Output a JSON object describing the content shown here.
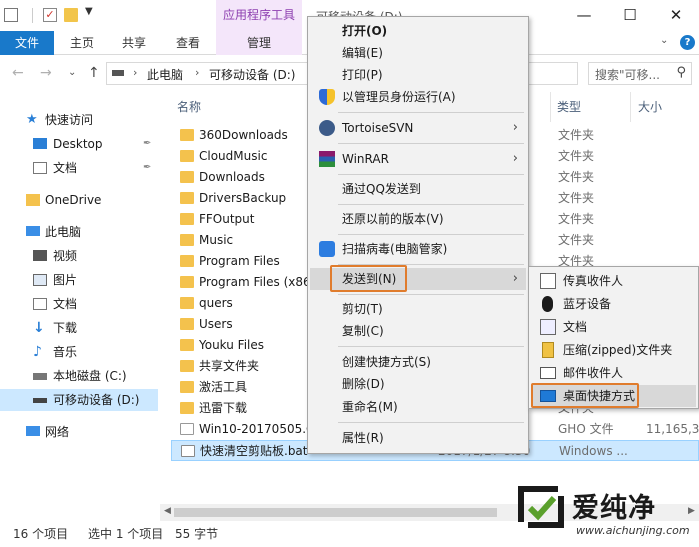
{
  "titlebar": {
    "context_tab": "应用程序工具",
    "window_title": "可移动设备 (D:)",
    "minimize": "—",
    "maximize": "☐",
    "close": "✕"
  },
  "ribbon": {
    "tabs": [
      "文件",
      "主页",
      "共享",
      "查看",
      "管理"
    ],
    "chevron": "⌄",
    "help": "?"
  },
  "address": {
    "back": "←",
    "forward": "→",
    "history": "⌄",
    "up": "↑",
    "crumbs": [
      "此电脑",
      "可移动设备 (D:)"
    ],
    "separator": "›",
    "dropdown": "⌄",
    "refresh": "↻",
    "search_placeholder": "搜索\"可移...",
    "search_icon": "⚲"
  },
  "nav": {
    "items": [
      {
        "label": "快速访问",
        "icon": "star-icon"
      },
      {
        "label": "Desktop",
        "icon": "desktop-icon",
        "pinned": true
      },
      {
        "label": "文档",
        "icon": "documents-icon",
        "pinned": true
      },
      {
        "label": "OneDrive",
        "icon": "folder-icon"
      },
      {
        "label": "此电脑",
        "icon": "computer-icon"
      },
      {
        "label": "视频",
        "icon": "video-icon"
      },
      {
        "label": "图片",
        "icon": "pictures-icon"
      },
      {
        "label": "文档",
        "icon": "documents-icon"
      },
      {
        "label": "下载",
        "icon": "download-icon"
      },
      {
        "label": "音乐",
        "icon": "music-icon"
      },
      {
        "label": "本地磁盘 (C:)",
        "icon": "drive-icon"
      },
      {
        "label": "可移动设备 (D:)",
        "icon": "usb-drive-icon",
        "selected": true
      },
      {
        "label": "网络",
        "icon": "network-icon"
      }
    ],
    "pin_glyph": "📌"
  },
  "filelist": {
    "headers": {
      "name": "名称",
      "type": "类型",
      "size": "大小"
    },
    "rows": [
      {
        "name": "360Downloads",
        "type": "文件夹",
        "size": ""
      },
      {
        "name": "CloudMusic",
        "type": "文件夹",
        "size": ""
      },
      {
        "name": "Downloads",
        "type": "文件夹",
        "size": ""
      },
      {
        "name": "DriversBackup",
        "type": "文件夹",
        "size": ""
      },
      {
        "name": "FFOutput",
        "type": "文件夹",
        "size": ""
      },
      {
        "name": "Music",
        "type": "文件夹",
        "size": ""
      },
      {
        "name": "Program Files",
        "type": "文件夹",
        "size": ""
      },
      {
        "name": "Program Files (x86)",
        "type": "文件夹",
        "size": ""
      },
      {
        "name": "quers",
        "type": "文件夹",
        "size": ""
      },
      {
        "name": "Users",
        "type": "文件夹",
        "size": ""
      },
      {
        "name": "Youku Files",
        "type": "文件夹",
        "size": ""
      },
      {
        "name": "共享文件夹",
        "type": "文件夹",
        "size": ""
      },
      {
        "name": "激活工具",
        "type": "文件夹",
        "size": ""
      },
      {
        "name": "迅雷下载",
        "type": "文件夹",
        "size": ""
      },
      {
        "name": "Win10-20170505.GHO",
        "type": "GHO 文件",
        "size": "11,165,32"
      },
      {
        "name": "快速清空剪贴板.bat",
        "type": "Windows ...",
        "size": "",
        "date": "2017/1/27 8:30",
        "selected": true
      }
    ]
  },
  "status": {
    "count": "16 个项目",
    "selected": "选中 1 个项目",
    "bytes": "55 字节"
  },
  "context_menu": {
    "items": [
      {
        "label": "打开(O)",
        "bold": true
      },
      {
        "label": "编辑(E)"
      },
      {
        "label": "打印(P)"
      },
      {
        "label": "以管理员身份运行(A)",
        "icon": "shield-icon"
      },
      {
        "label": "TortoiseSVN",
        "icon": "tortoisesvn-icon",
        "submenu": true
      },
      {
        "label": "WinRAR",
        "icon": "winrar-icon",
        "submenu": true
      },
      {
        "label": "通过QQ发送到"
      },
      {
        "label": "还原以前的版本(V)"
      },
      {
        "label": "扫描病毒(电脑管家)",
        "icon": "pc-manager-icon"
      },
      {
        "label": "发送到(N)",
        "submenu": true,
        "highlighted": true
      },
      {
        "label": "剪切(T)"
      },
      {
        "label": "复制(C)"
      },
      {
        "label": "创建快捷方式(S)"
      },
      {
        "label": "删除(D)"
      },
      {
        "label": "重命名(M)"
      },
      {
        "label": "属性(R)"
      }
    ],
    "arrow": "›"
  },
  "sendto_menu": {
    "items": [
      {
        "label": "传真收件人",
        "icon": "fax-icon"
      },
      {
        "label": "蓝牙设备",
        "icon": "bluetooth-icon"
      },
      {
        "label": "文档",
        "icon": "documents-icon"
      },
      {
        "label": "压缩(zipped)文件夹",
        "icon": "zip-folder-icon"
      },
      {
        "label": "邮件收件人",
        "icon": "mail-icon"
      },
      {
        "label": "桌面快捷方式",
        "icon": "desktop-shortcut-icon",
        "highlighted": true
      }
    ]
  },
  "watermark": {
    "text": "爱纯净",
    "url": "www.aichunjing.com"
  },
  "colors": {
    "accent": "#1979ca",
    "context_tab": "#f4e6fa",
    "selection": "#cce8ff",
    "highlight_box": "#e07c2d"
  }
}
